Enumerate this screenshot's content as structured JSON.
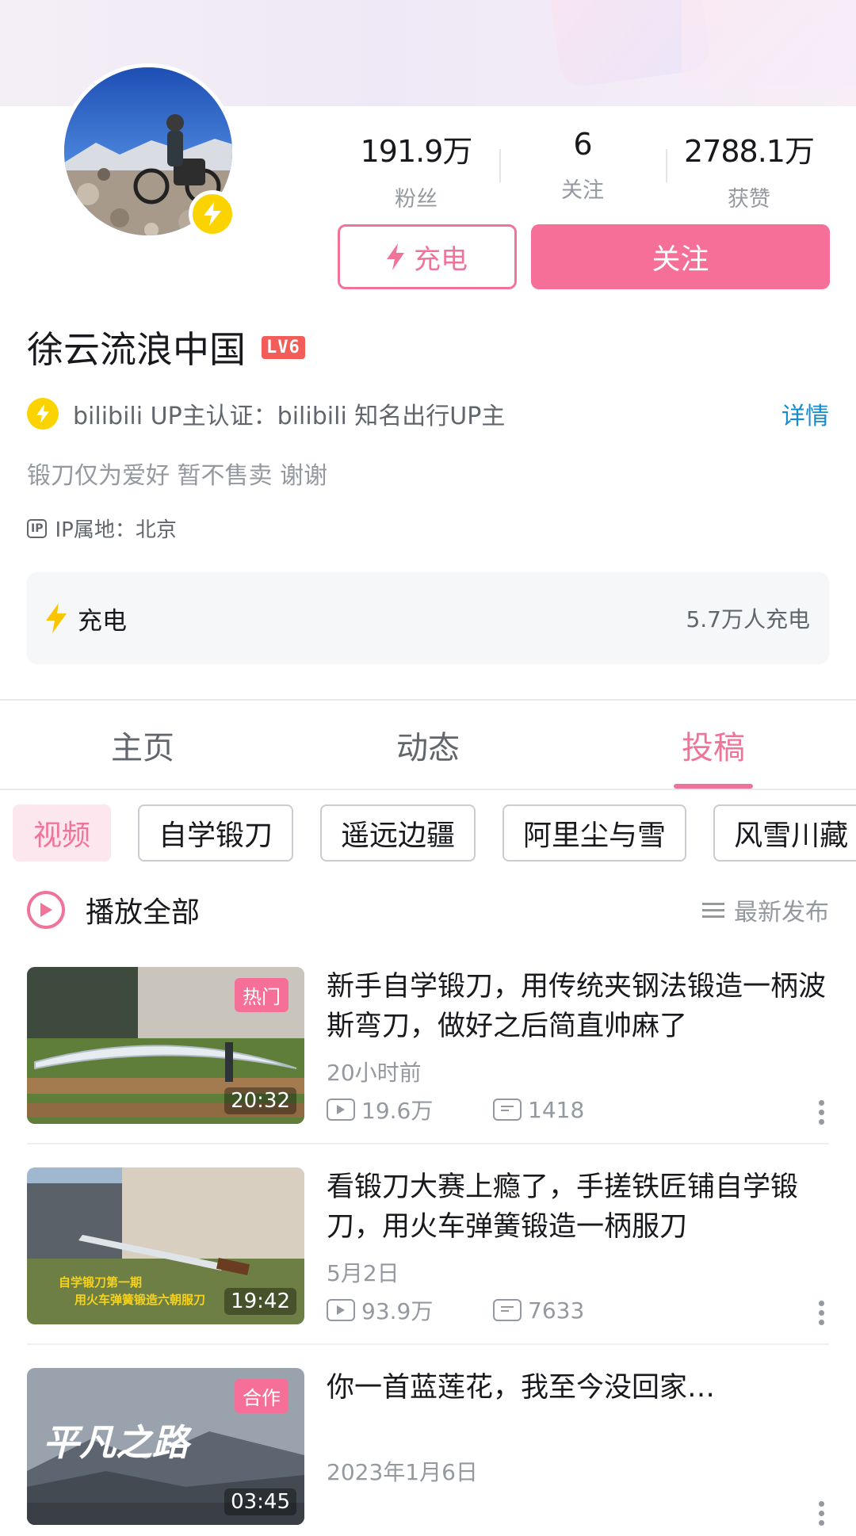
{
  "profile": {
    "name": "徐云流浪中国",
    "level": "LV6",
    "stats": [
      {
        "value": "191.9万",
        "label": "粉丝"
      },
      {
        "value": "6",
        "label": "关注"
      },
      {
        "value": "2788.1万",
        "label": "获赞"
      }
    ],
    "charge_button": "充电",
    "follow_button": "关注",
    "verify_text": "bilibili UP主认证：bilibili 知名出行UP主",
    "verify_detail": "详情",
    "sign": "锻刀仅为爱好 暂不售卖 谢谢",
    "ip_badge": "IP",
    "ip_location": "IP属地：北京",
    "charge_bar_label": "充电",
    "charge_bar_count": "5.7万人充电"
  },
  "tabs": [
    {
      "label": "主页",
      "active": false
    },
    {
      "label": "动态",
      "active": false
    },
    {
      "label": "投稿",
      "active": true
    }
  ],
  "chips": [
    {
      "label": "视频",
      "active": true
    },
    {
      "label": "自学锻刀",
      "active": false
    },
    {
      "label": "遥远边疆",
      "active": false
    },
    {
      "label": "阿里尘与雪",
      "active": false
    },
    {
      "label": "风雪川藏",
      "active": false
    }
  ],
  "playall": {
    "label": "播放全部",
    "sort_label": "最新发布"
  },
  "videos": [
    {
      "title": "新手自学锻刀，用传统夹钢法锻造一柄波斯弯刀，做好之后简直帅麻了",
      "date": "20小时前",
      "views": "19.6万",
      "comments": "1418",
      "duration": "20:32",
      "tag": "热门"
    },
    {
      "title": "看锻刀大赛上瘾了，手搓铁匠铺自学锻刀，用火车弹簧锻造一柄服刀",
      "date": "5月2日",
      "views": "93.9万",
      "comments": "7633",
      "duration": "19:42",
      "overlay_line1": "自学锻刀第一期",
      "overlay_line2": "用火车弹簧锻造六朝服刀"
    },
    {
      "title": "你一首蓝莲花，我至今没回家…",
      "date": "2023年1月6日",
      "duration": "03:45",
      "tag": "合作",
      "overlay_title": "平凡之路"
    }
  ],
  "colors": {
    "accent_pink": "#f66f98",
    "link_blue": "#178bcf",
    "charge_yellow": "#fbd300",
    "level_red": "#f25d59"
  }
}
